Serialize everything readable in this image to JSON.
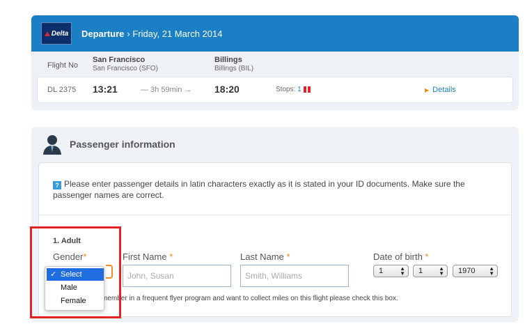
{
  "flight": {
    "airline_logo": "Delta",
    "departure_label": "Departure",
    "date": "› Friday, 21 March 2014",
    "flight_no_label": "Flight No",
    "origin_city": "San Francisco",
    "origin_code": "San Francisco (SFO)",
    "destination_city": "Billings",
    "destination_code": "Billings (BIL)",
    "number": "DL 2375",
    "depart_time": "13:21",
    "duration": "— 3h 59min →",
    "arrive_time": "18:20",
    "stops_label": "Stops:",
    "stops_count": "1",
    "details_label": "Details"
  },
  "passenger": {
    "title": "Passenger information",
    "info_text": "Please enter passenger details in latin characters exactly as it is stated in your ID documents. Make sure the passenger names are correct.",
    "info_icon": "?",
    "adult_label": "1. Adult",
    "gender_label": "Gender",
    "first_name_label": "First Name",
    "first_name_placeholder": "John, Susan",
    "last_name_label": "Last Name",
    "last_name_placeholder": "Smith, Williams",
    "dob_label": "Date of birth",
    "dob_day": "1",
    "dob_month": "1",
    "dob_year": "1970",
    "required_mark": "*",
    "frequent_flyer_text": "member in a frequent flyer program and want to collect miles on this flight please check this box."
  },
  "gender_dropdown": {
    "check": "✓",
    "options": [
      "Select",
      "Male",
      "Female"
    ],
    "selected_index": 0
  },
  "colors": {
    "header_blue": "#1a7fc4",
    "accent_orange": "#f28c18",
    "highlight_red": "#e32222",
    "selected_blue": "#1f6de0"
  }
}
